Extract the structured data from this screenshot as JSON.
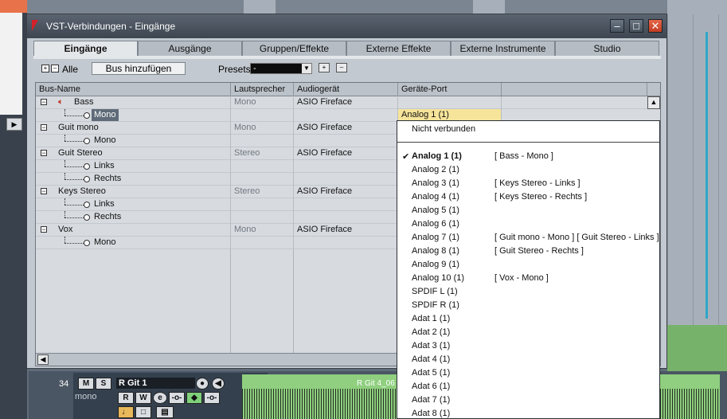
{
  "dialog": {
    "title": "VST-Verbindungen - Eingänge",
    "tabs": [
      {
        "label": "Eingänge"
      },
      {
        "label": "Ausgänge"
      },
      {
        "label": "Gruppen/Effekte"
      },
      {
        "label": "Externe Effekte"
      },
      {
        "label": "Externe Instrumente"
      },
      {
        "label": "Studio"
      }
    ],
    "toolbar": {
      "all_label": "Alle",
      "add_bus_label": "Bus hinzufügen",
      "presets_label": "Presets",
      "presets_value": "-"
    },
    "columns": [
      "Bus-Name",
      "Lautsprecher",
      "Audiogerät",
      "Geräte-Port"
    ],
    "rows": [
      {
        "name": "Bass",
        "speaker": "Mono",
        "device": "ASIO Fireface",
        "port": ""
      },
      {
        "name": "Mono",
        "speaker": "",
        "device": "",
        "port": "Analog 1 (1)"
      },
      {
        "name": "Guit mono",
        "speaker": "Mono",
        "device": "ASIO Fireface",
        "port": ""
      },
      {
        "name": "Mono",
        "speaker": "",
        "device": "",
        "port": ""
      },
      {
        "name": "Guit Stereo",
        "speaker": "Stereo",
        "device": "ASIO Fireface",
        "port": ""
      },
      {
        "name": "Links",
        "speaker": "",
        "device": "",
        "port": ""
      },
      {
        "name": "Rechts",
        "speaker": "",
        "device": "",
        "port": ""
      },
      {
        "name": "Keys Stereo",
        "speaker": "Stereo",
        "device": "ASIO Fireface",
        "port": ""
      },
      {
        "name": "Links",
        "speaker": "",
        "device": "",
        "port": ""
      },
      {
        "name": "Rechts",
        "speaker": "",
        "device": "",
        "port": ""
      },
      {
        "name": "Vox",
        "speaker": "Mono",
        "device": "ASIO Fireface",
        "port": ""
      },
      {
        "name": "Mono",
        "speaker": "",
        "device": "",
        "port": ""
      }
    ],
    "dropdown": {
      "not_connected": "Nicht verbunden",
      "items": [
        {
          "name": "Analog 1 (1)",
          "conn": "[ Bass - Mono ]"
        },
        {
          "name": "Analog 2 (1)",
          "conn": ""
        },
        {
          "name": "Analog 3 (1)",
          "conn": "[ Keys Stereo - Links ]"
        },
        {
          "name": "Analog 4 (1)",
          "conn": "[ Keys Stereo - Rechts ]"
        },
        {
          "name": "Analog 5 (1)",
          "conn": ""
        },
        {
          "name": "Analog 6 (1)",
          "conn": ""
        },
        {
          "name": "Analog 7 (1)",
          "conn": "[ Guit mono - Mono ] [ Guit Stereo - Links ]"
        },
        {
          "name": "Analog 8 (1)",
          "conn": "[ Guit Stereo - Rechts ]"
        },
        {
          "name": "Analog 9 (1)",
          "conn": ""
        },
        {
          "name": "Analog 10 (1)",
          "conn": "[ Vox - Mono ]"
        },
        {
          "name": "SPDIF L (1)",
          "conn": ""
        },
        {
          "name": "SPDIF R (1)",
          "conn": ""
        },
        {
          "name": "Adat 1 (1)",
          "conn": ""
        },
        {
          "name": "Adat 2 (1)",
          "conn": ""
        },
        {
          "name": "Adat 3 (1)",
          "conn": ""
        },
        {
          "name": "Adat 4 (1)",
          "conn": ""
        },
        {
          "name": "Adat 5 (1)",
          "conn": ""
        },
        {
          "name": "Adat 6 (1)",
          "conn": ""
        },
        {
          "name": "Adat 7 (1)",
          "conn": ""
        },
        {
          "name": "Adat 8 (1)",
          "conn": ""
        }
      ],
      "checked_index": 0
    }
  },
  "track": {
    "number": "34",
    "name": "R Git 1",
    "channel": "mono",
    "m_label": "M",
    "s_label": "S",
    "r_label": "R",
    "w_label": "W",
    "clip_label": "R Git 4_06"
  },
  "colors": {
    "close_button": "#d84a2e",
    "port_highlight": "#f6e49a",
    "waveform_bg": "#8fcf7f"
  }
}
